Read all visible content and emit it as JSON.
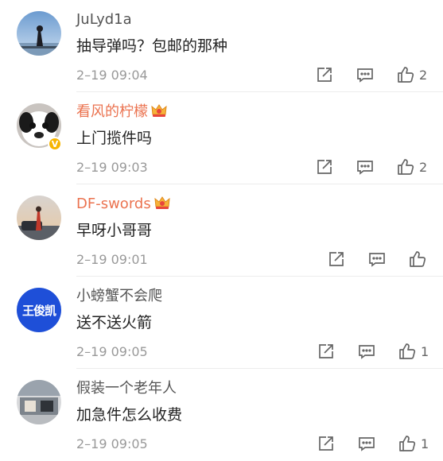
{
  "comments": [
    {
      "user": "JuLyd1a",
      "text": "抽导弹吗？包邮的那种",
      "time": "2–19 09:04",
      "likes": "2",
      "verified": false,
      "crown": false
    },
    {
      "user": "看风的柠檬",
      "text": "上门揽件吗",
      "time": "2–19 09:03",
      "likes": "2",
      "verified": true,
      "crown": true
    },
    {
      "user": "DF-swords",
      "text": "早呀小哥哥",
      "time": "2–19 09:01",
      "likes": "",
      "verified": false,
      "crown": true
    },
    {
      "user": "小螃蟹不会爬",
      "text": "送不送火箭",
      "time": "2–19 09:05",
      "likes": "1",
      "verified": false,
      "crown": false,
      "avatar_text": "王俊凯"
    },
    {
      "user": "假装一个老年人",
      "text": "加急件怎么收费",
      "time": "2–19 09:05",
      "likes": "1",
      "verified": false,
      "crown": false
    }
  ],
  "colors": {
    "vip_name": "#eb7350",
    "name": "#555555",
    "verified_badge": "#f7b500",
    "avatar_blue": "#1e4fd8"
  },
  "icons": [
    "repost-icon",
    "comment-icon",
    "like-icon",
    "crown-icon",
    "verified-badge-icon"
  ]
}
